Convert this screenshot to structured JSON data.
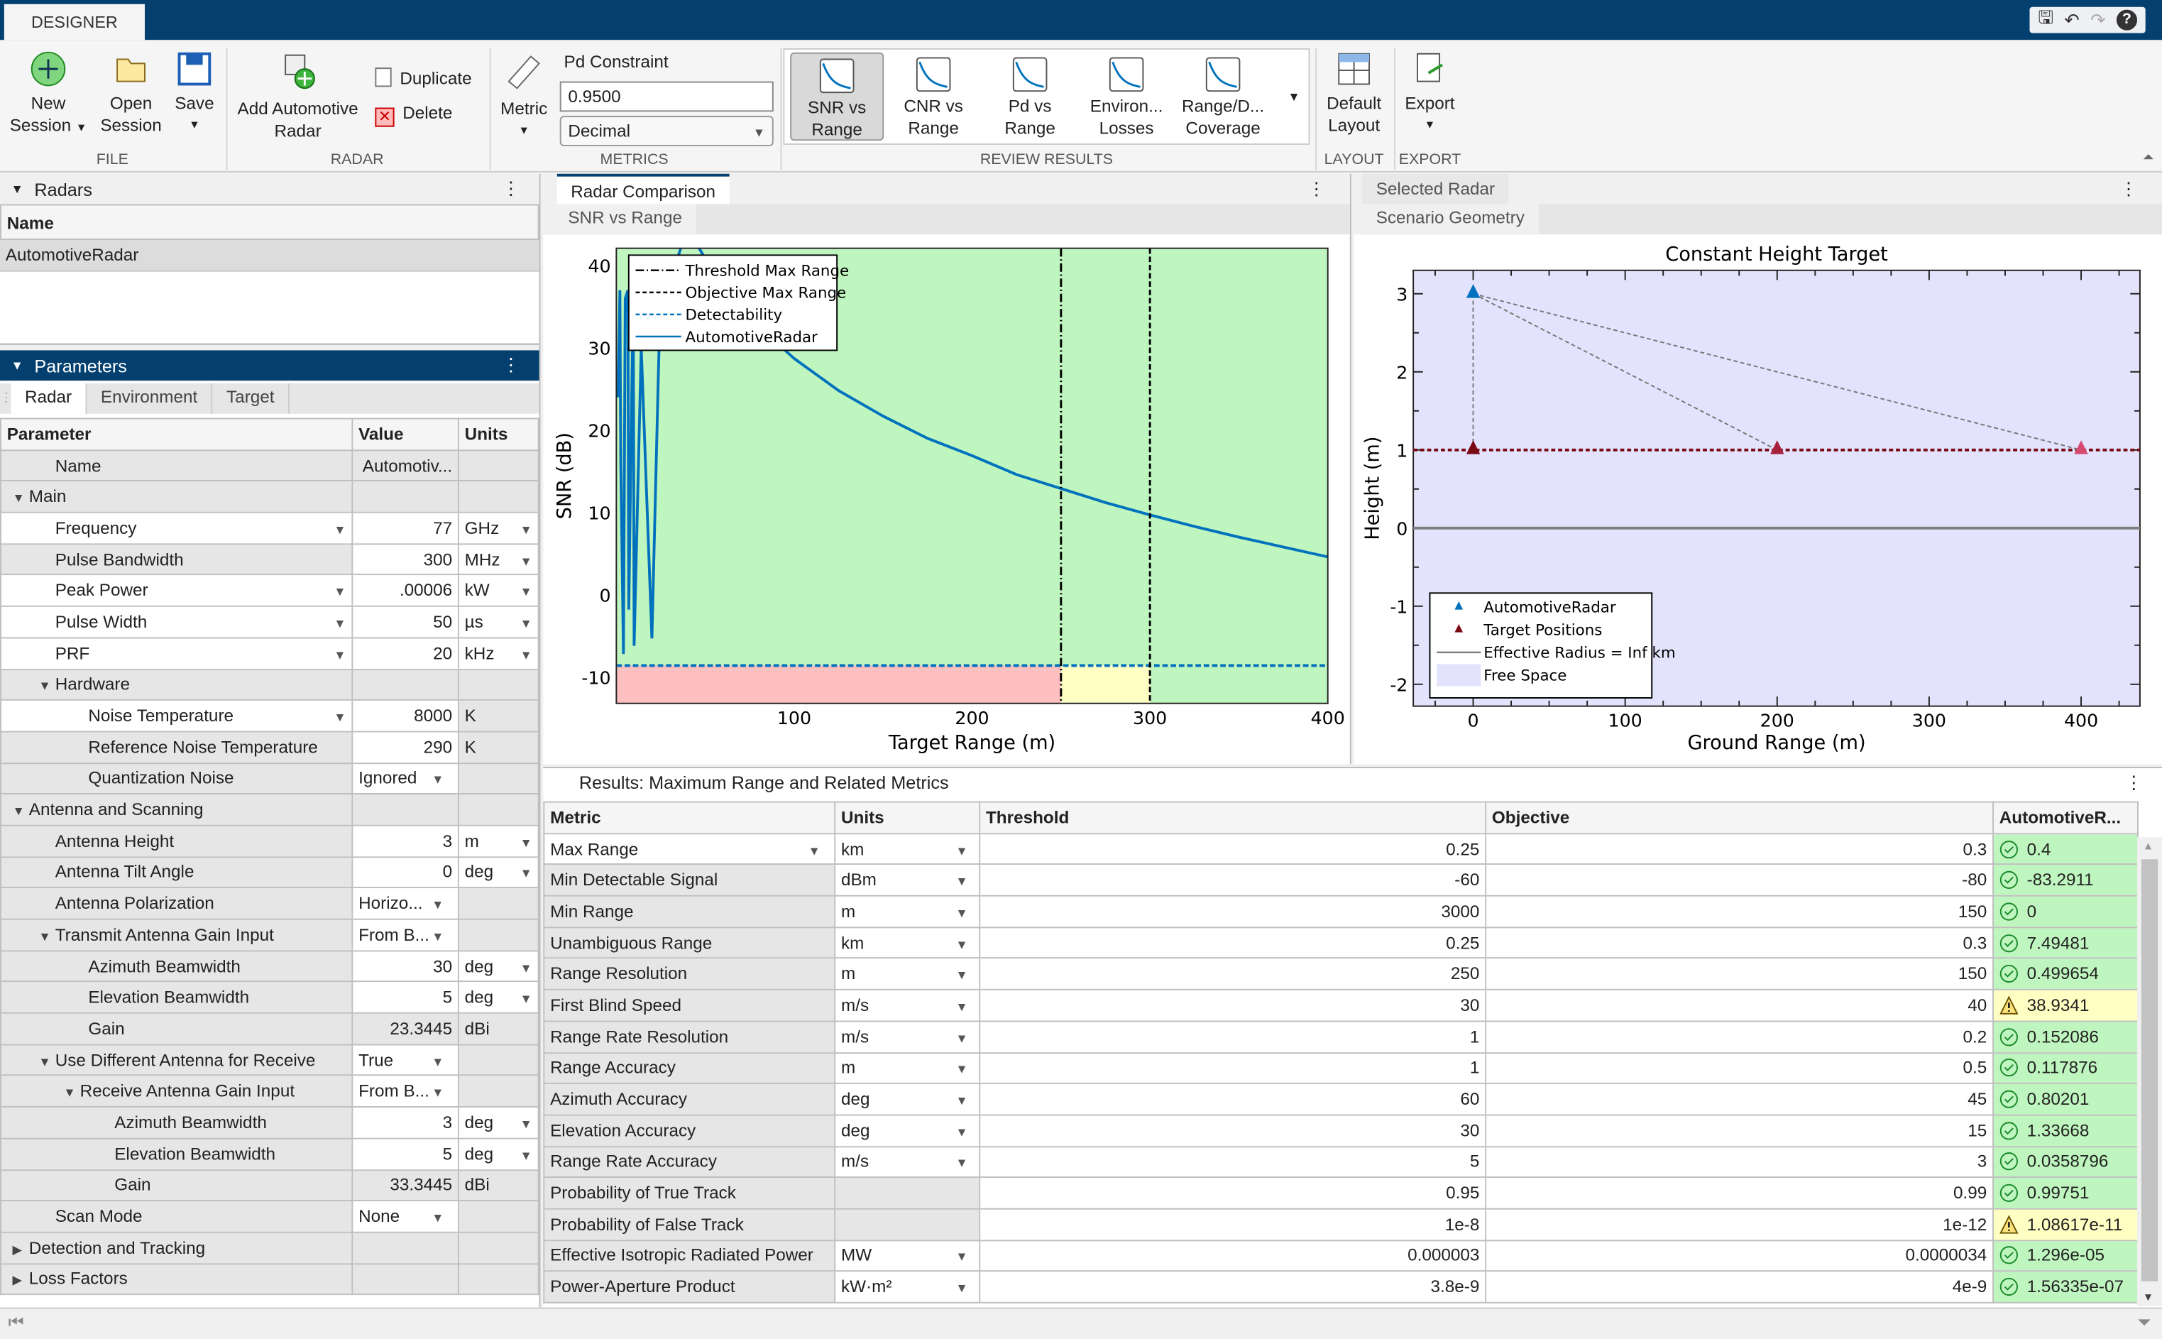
{
  "app": {
    "tab": "DESIGNER"
  },
  "toolstrip": {
    "file": {
      "section": "FILE",
      "new_session": [
        "New",
        "Session"
      ],
      "open_session": [
        "Open",
        "Session"
      ],
      "save": "Save"
    },
    "radar": {
      "section": "RADAR",
      "add": [
        "Add Automotive",
        "Radar"
      ],
      "duplicate": "Duplicate",
      "delete": "Delete"
    },
    "metrics": {
      "section": "METRICS",
      "metric": "Metric",
      "pd_label": "Pd Constraint",
      "pd_value": "0.9500",
      "format": "Decimal"
    },
    "review": {
      "section": "REVIEW RESULTS",
      "items": [
        {
          "l1": "SNR vs",
          "l2": "Range",
          "selected": true
        },
        {
          "l1": "CNR vs",
          "l2": "Range"
        },
        {
          "l1": "Pd vs",
          "l2": "Range"
        },
        {
          "l1": "Environ...",
          "l2": "Losses"
        },
        {
          "l1": "Range/D...",
          "l2": "Coverage"
        }
      ]
    },
    "layout": {
      "section": "LAYOUT",
      "default": [
        "Default",
        "Layout"
      ]
    },
    "export": {
      "section": "EXPORT",
      "label": "Export"
    }
  },
  "radars": {
    "title": "Radars",
    "col": "Name",
    "items": [
      "AutomotiveRadar"
    ]
  },
  "parameters": {
    "title": "Parameters",
    "tabs": [
      "Radar",
      "Environment",
      "Target"
    ],
    "cols": [
      "Parameter",
      "Value",
      "Units"
    ],
    "rows": [
      {
        "lvl": 1,
        "label": "Name",
        "value": "Automotiv...",
        "units": "",
        "vgray": true
      },
      {
        "lvl": 0,
        "tri": "down",
        "label": "Main",
        "section": true
      },
      {
        "lvl": 1,
        "label": "Frequency",
        "ldd": true,
        "value": "77",
        "units": "GHz",
        "udd": true
      },
      {
        "lvl": 1,
        "label": "Pulse Bandwidth",
        "value": "300",
        "units": "MHz",
        "udd": true
      },
      {
        "lvl": 1,
        "label": "Peak Power",
        "ldd": true,
        "value": ".00006",
        "units": "kW",
        "udd": true
      },
      {
        "lvl": 1,
        "label": "Pulse Width",
        "ldd": true,
        "value": "50",
        "units": "µs",
        "udd": true
      },
      {
        "lvl": 1,
        "label": "PRF",
        "ldd": true,
        "value": "20",
        "units": "kHz",
        "udd": true
      },
      {
        "lvl": 1,
        "tri": "down",
        "label": "Hardware",
        "section": true
      },
      {
        "lvl": 2,
        "label": "Noise Temperature",
        "ldd": true,
        "value": "8000",
        "units": "K"
      },
      {
        "lvl": 2,
        "label": "Reference Noise Temperature",
        "value": "290",
        "units": "K"
      },
      {
        "lvl": 2,
        "label": "Quantization Noise",
        "value": "Ignored",
        "vdd": true,
        "units": ""
      },
      {
        "lvl": 0,
        "tri": "down",
        "label": "Antenna and Scanning",
        "section": true
      },
      {
        "lvl": 1,
        "label": "Antenna Height",
        "value": "3",
        "units": "m",
        "udd": true
      },
      {
        "lvl": 1,
        "label": "Antenna Tilt Angle",
        "value": "0",
        "units": "deg",
        "udd": true
      },
      {
        "lvl": 1,
        "label": "Antenna Polarization",
        "value": "Horizo...",
        "vdd": true,
        "units": ""
      },
      {
        "lvl": 1,
        "tri": "down",
        "label": "Transmit Antenna Gain Input",
        "value": "From B...",
        "vdd": true,
        "units": ""
      },
      {
        "lvl": 2,
        "label": "Azimuth Beamwidth",
        "value": "30",
        "units": "deg",
        "udd": true
      },
      {
        "lvl": 2,
        "label": "Elevation Beamwidth",
        "value": "5",
        "units": "deg",
        "udd": true
      },
      {
        "lvl": 2,
        "label": "Gain",
        "value": "23.3445",
        "units": "dBi",
        "vgray": true
      },
      {
        "lvl": 1,
        "tri": "down",
        "label": "Use Different Antenna for Receive",
        "value": "True",
        "vdd": true,
        "units": ""
      },
      {
        "lvl": 2,
        "tri": "down",
        "label": "Receive Antenna Gain Input",
        "value": "From B...",
        "vdd": true,
        "units": ""
      },
      {
        "lvl": 3,
        "label": "Azimuth Beamwidth",
        "value": "3",
        "units": "deg",
        "udd": true
      },
      {
        "lvl": 3,
        "label": "Elevation Beamwidth",
        "value": "5",
        "units": "deg",
        "udd": true
      },
      {
        "lvl": 3,
        "label": "Gain",
        "value": "33.3445",
        "units": "dBi",
        "vgray": true
      },
      {
        "lvl": 1,
        "label": "Scan Mode",
        "value": "None",
        "vdd": true,
        "units": ""
      },
      {
        "lvl": 0,
        "tri": "right",
        "label": "Detection and Tracking",
        "section": true
      },
      {
        "lvl": 0,
        "tri": "right",
        "label": "Loss Factors",
        "section": true
      }
    ]
  },
  "comparison": {
    "doc_tab": "Radar Comparison",
    "sub_tab": "SNR vs Range"
  },
  "selected": {
    "doc_tab": "Selected Radar",
    "sub_tab": "Scenario Geometry"
  },
  "chart_data": [
    {
      "type": "line",
      "xlabel": "Target Range (m)",
      "ylabel": "SNR (dB)",
      "xlim": [
        0,
        400
      ],
      "ylim": [
        -13.2,
        42.1
      ],
      "xticks": [
        100,
        200,
        300,
        400
      ],
      "yticks": [
        -10,
        0,
        10,
        20,
        30,
        40
      ],
      "grid": false,
      "legend": "top-left",
      "regions": [
        {
          "name": "fail",
          "x": [
            0,
            250
          ],
          "color": "#fdbfbf",
          "below": -8.6
        },
        {
          "name": "warn",
          "x": [
            250,
            300
          ],
          "color": "#ffffc4",
          "below": -8.6
        },
        {
          "name": "pass",
          "color": "#bff5bf"
        }
      ],
      "series": [
        {
          "name": "Threshold Max Range",
          "style": "dashdot",
          "color": "#000000",
          "x": 250
        },
        {
          "name": "Objective Max Range",
          "style": "dashed",
          "color": "#000000",
          "x": 300
        },
        {
          "name": "Detectability",
          "style": "dashed",
          "color": "#0072bd",
          "y": -8.6
        },
        {
          "name": "AutomotiveRadar",
          "style": "solid",
          "color": "#0072bd",
          "x": [
            1,
            2,
            2.5,
            4,
            5,
            6.5,
            7,
            9.5,
            10,
            14,
            20,
            24,
            26,
            30,
            40,
            50,
            60,
            80,
            100,
            125,
            150,
            175,
            200,
            225,
            250,
            275,
            300,
            325,
            350,
            375,
            400
          ],
          "y": [
            24,
            37,
            16,
            -7.2,
            36,
            37,
            -1.8,
            37.5,
            -6.2,
            30,
            -5.3,
            30,
            34,
            38,
            44.6,
            40.8,
            37.6,
            32.6,
            28.7,
            24.8,
            21.7,
            19.0,
            16.9,
            14.6,
            12.9,
            11.2,
            9.7,
            8.3,
            7.0,
            5.8,
            4.6
          ]
        }
      ]
    },
    {
      "type": "scatter",
      "title": "Constant Height Target",
      "xlabel": "Ground Range (m)",
      "ylabel": "Height (m)",
      "xlim": [
        -39.4,
        438.7
      ],
      "ylim": [
        -2.28,
        3.3
      ],
      "xticks": [
        0,
        100,
        200,
        300,
        400
      ],
      "yticks": [
        -2,
        -1,
        0,
        1,
        2,
        3
      ],
      "grid": false,
      "legend": "bottom-left",
      "background": "#e3e3fd",
      "series": [
        {
          "name": "AutomotiveRadar",
          "marker": "triangle",
          "color": "#0072bd",
          "x": [
            0
          ],
          "y": [
            3
          ]
        },
        {
          "name": "Target Positions",
          "marker": "triangle",
          "colors": [
            "#7a0a14",
            "#a8213c",
            "#d64a72"
          ],
          "x": [
            0,
            200,
            400
          ],
          "y": [
            1,
            1,
            1
          ]
        },
        {
          "name": "Effective Radius = Inf km",
          "style": "solid",
          "color": "#808080",
          "y": 0
        },
        {
          "name": "Free Space",
          "style": "patch",
          "color": "#e3e3fd"
        }
      ]
    }
  ],
  "results": {
    "title": "Results: Maximum Range and Related Metrics",
    "cols": [
      "Metric",
      "Units",
      "Threshold",
      "Objective",
      "AutomotiveR..."
    ],
    "status_colors": {
      "pass": "#bff5bf",
      "warn": "#ffffc4"
    },
    "rows": [
      {
        "metric": "Max Range",
        "mdd": true,
        "units": "km",
        "threshold": "0.25",
        "objective": "0.3",
        "value": "0.4",
        "status": "pass"
      },
      {
        "metric": "Min Detectable Signal",
        "units": "dBm",
        "threshold": "-60",
        "objective": "-80",
        "value": "-83.2911",
        "status": "pass"
      },
      {
        "metric": "Min Range",
        "units": "m",
        "threshold": "3000",
        "objective": "150",
        "value": "0",
        "status": "pass"
      },
      {
        "metric": "Unambiguous Range",
        "units": "km",
        "threshold": "0.25",
        "objective": "0.3",
        "value": "7.49481",
        "status": "pass"
      },
      {
        "metric": "Range Resolution",
        "units": "m",
        "threshold": "250",
        "objective": "150",
        "value": "0.499654",
        "status": "pass"
      },
      {
        "metric": "First Blind Speed",
        "units": "m/s",
        "threshold": "30",
        "objective": "40",
        "value": "38.9341",
        "status": "warn"
      },
      {
        "metric": "Range Rate Resolution",
        "units": "m/s",
        "threshold": "1",
        "objective": "0.2",
        "value": "0.152086",
        "status": "pass"
      },
      {
        "metric": "Range Accuracy",
        "units": "m",
        "threshold": "1",
        "objective": "0.5",
        "value": "0.117876",
        "status": "pass"
      },
      {
        "metric": "Azimuth Accuracy",
        "units": "deg",
        "threshold": "60",
        "objective": "45",
        "value": "0.80201",
        "status": "pass"
      },
      {
        "metric": "Elevation Accuracy",
        "units": "deg",
        "threshold": "30",
        "objective": "15",
        "value": "1.33668",
        "status": "pass"
      },
      {
        "metric": "Range Rate Accuracy",
        "units": "m/s",
        "threshold": "5",
        "objective": "3",
        "value": "0.0358796",
        "status": "pass"
      },
      {
        "metric": "Probability of True Track",
        "units": "",
        "threshold": "0.95",
        "objective": "0.99",
        "value": "0.99751",
        "status": "pass"
      },
      {
        "metric": "Probability of False Track",
        "units": "",
        "threshold": "1e-8",
        "objective": "1e-12",
        "value": "1.08617e-11",
        "status": "warn"
      },
      {
        "metric": "Effective Isotropic Radiated Power",
        "units": "MW",
        "threshold": "0.000003",
        "objective": "0.0000034",
        "value": "1.296e-05",
        "status": "pass"
      },
      {
        "metric": "Power-Aperture Product",
        "units": "kW·m²",
        "threshold": "3.8e-9",
        "objective": "4e-9",
        "value": "1.56335e-07",
        "status": "pass"
      }
    ]
  }
}
